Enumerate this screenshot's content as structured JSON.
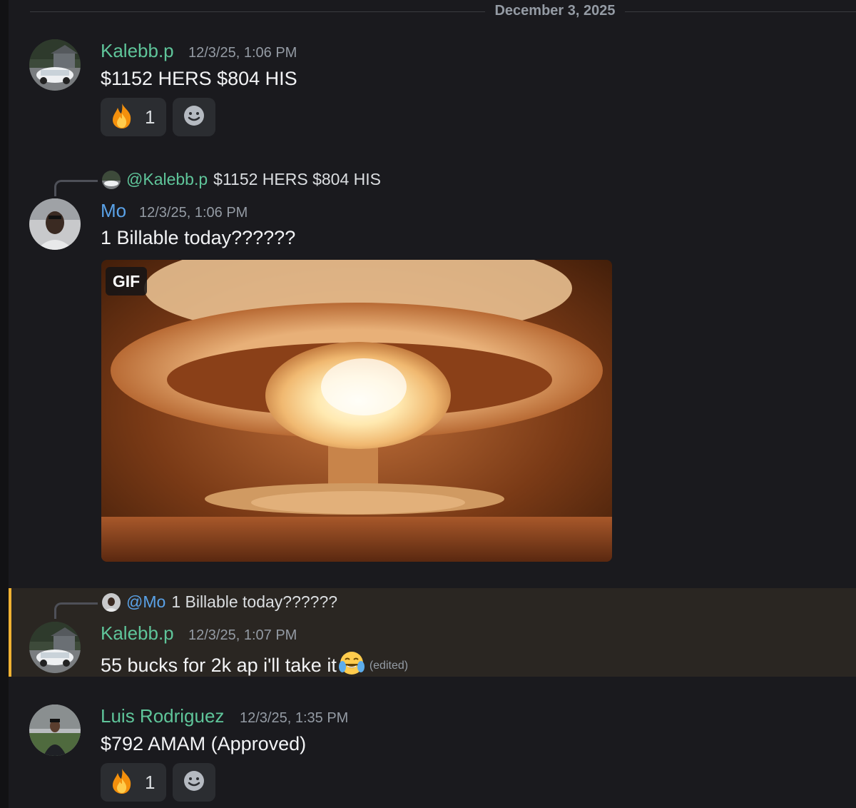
{
  "date_divider": "December 3, 2025",
  "messages": [
    {
      "username": "Kalebb.p",
      "timestamp": "12/3/25, 1:06 PM",
      "text": "$1152 HERS $804 HIS",
      "reaction": {
        "emoji": "fire-emoji",
        "count": "1"
      }
    },
    {
      "reply": {
        "mention": "@Kalebb.p",
        "text": "$1152 HERS $804 HIS"
      },
      "username": "Mo",
      "timestamp": "12/3/25, 1:06 PM",
      "text": "1 Billable today??????",
      "attachment": {
        "badge": "GIF",
        "icon": "mushroom-cloud-explosion-gif"
      }
    },
    {
      "reply": {
        "mention": "@Mo",
        "text": "1 Billable today??????"
      },
      "username": "Kalebb.p",
      "timestamp": "12/3/25, 1:07 PM",
      "text": "55 bucks for 2k ap i'll take it",
      "emoji": "tears-of-joy-emoji",
      "edited": "(edited)",
      "highlight_color": "#f0b232"
    },
    {
      "username": "Luis Rodriguez",
      "timestamp": "12/3/25, 1:35 PM",
      "text": "$792 AMAM (Approved)",
      "reaction": {
        "emoji": "fire-emoji",
        "count": "1"
      }
    }
  ],
  "colors": {
    "background": "#1a1a1e",
    "username_green": "#5fc59a",
    "username_blue": "#5aa2e8",
    "timestamp": "#949ba4",
    "reaction_bg": "#2b2d31"
  }
}
